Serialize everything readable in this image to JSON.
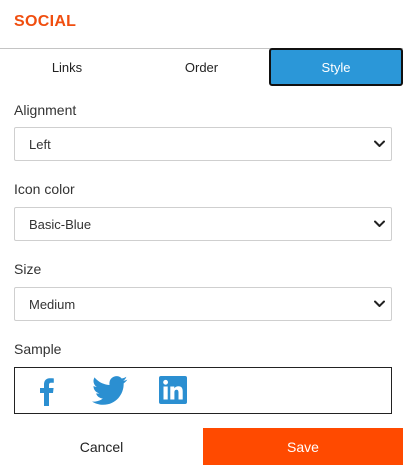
{
  "header": {
    "title": "SOCIAL"
  },
  "tabs": [
    {
      "label": "Links"
    },
    {
      "label": "Order"
    },
    {
      "label": "Style",
      "active": true
    }
  ],
  "fields": {
    "alignment": {
      "label": "Alignment",
      "value": "Left"
    },
    "icon_color": {
      "label": "Icon color",
      "value": "Basic-Blue"
    },
    "size": {
      "label": "Size",
      "value": "Medium"
    }
  },
  "sample": {
    "label": "Sample",
    "icons": [
      "facebook-icon",
      "twitter-icon",
      "linkedin-icon"
    ],
    "icon_color": "#2b8fd1"
  },
  "footer": {
    "cancel_label": "Cancel",
    "save_label": "Save"
  },
  "colors": {
    "brand": "#f04e0f",
    "active_tab": "#2b97d8",
    "save_button": "#ff4a00"
  }
}
